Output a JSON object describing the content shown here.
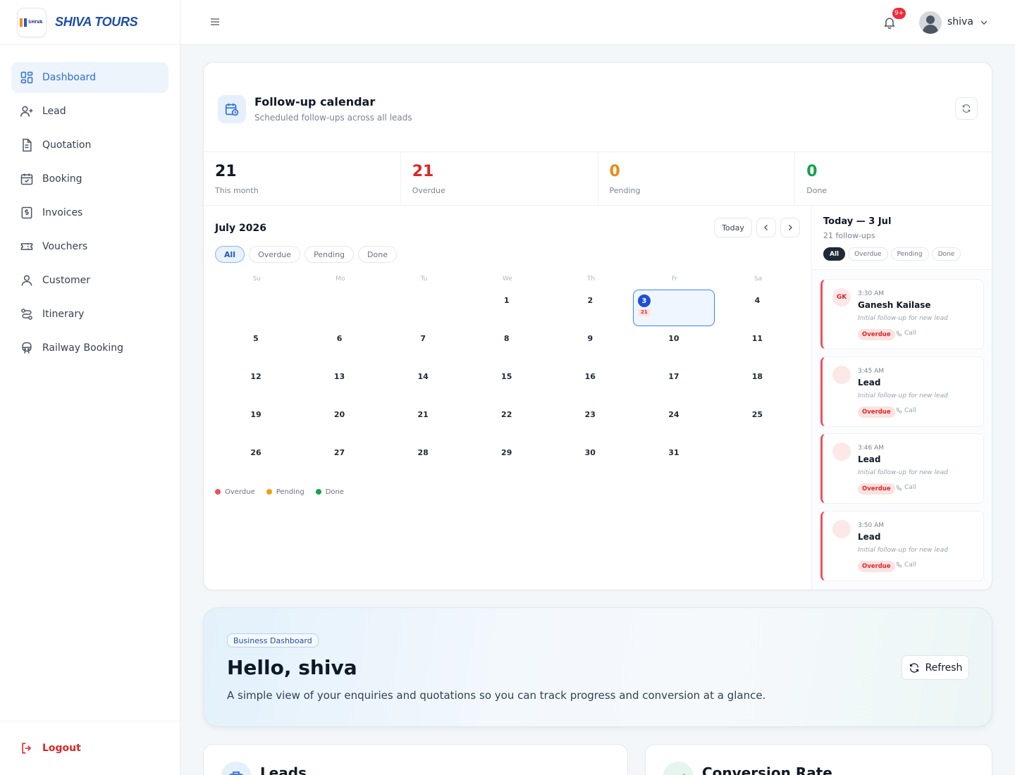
{
  "brand": {
    "name": "SHIVA TOURS",
    "logo_text": "SHIVA"
  },
  "sidebar": {
    "items": [
      {
        "label": "Dashboard",
        "icon": "dashboard-icon",
        "active": true
      },
      {
        "label": "Lead",
        "icon": "user-plus-icon"
      },
      {
        "label": "Quotation",
        "icon": "document-icon"
      },
      {
        "label": "Booking",
        "icon": "calendar-check-icon"
      },
      {
        "label": "Invoices",
        "icon": "invoice-dollar-icon"
      },
      {
        "label": "Vouchers",
        "icon": "ticket-icon"
      },
      {
        "label": "Customer",
        "icon": "user-icon"
      },
      {
        "label": "Itinerary",
        "icon": "route-icon"
      },
      {
        "label": "Railway Booking",
        "icon": "train-icon"
      }
    ],
    "logout_label": "Logout"
  },
  "topbar": {
    "notification_count": "9+",
    "username": "shiva"
  },
  "calendar": {
    "title": "Follow-up calendar",
    "subtitle": "Scheduled follow-ups across all leads",
    "stats": [
      {
        "value": "21",
        "label": "This month",
        "color": "#111827"
      },
      {
        "value": "21",
        "label": "Overdue",
        "color": "#dc2626"
      },
      {
        "value": "0",
        "label": "Pending",
        "color": "#ea8a12"
      },
      {
        "value": "0",
        "label": "Done",
        "color": "#16a34a"
      }
    ],
    "month_label": "July 2026",
    "today_label": "Today",
    "filters": [
      "All",
      "Overdue",
      "Pending",
      "Done"
    ],
    "active_filter": "All",
    "weekdays": [
      "Su",
      "Mo",
      "Tu",
      "We",
      "Th",
      "Fr",
      "Sa"
    ],
    "first_weekday_index": 3,
    "days_in_month": 31,
    "selected_day": 3,
    "selected_day_count": "21",
    "legend": [
      {
        "label": "Overdue",
        "color": "#ef4f5f"
      },
      {
        "label": "Pending",
        "color": "#f59e0b"
      },
      {
        "label": "Done",
        "color": "#16a34a"
      }
    ]
  },
  "today_panel": {
    "title": "Today — 3 Jul",
    "subtitle": "21 follow-ups",
    "filters": [
      "All",
      "Overdue",
      "Pending",
      "Done"
    ],
    "active_filter": "All",
    "items": [
      {
        "initials": "GK",
        "time": "3:30 AM",
        "name": "Ganesh Kailase",
        "note": "Initial follow-up for new lead",
        "status": "Overdue",
        "type": "Call"
      },
      {
        "initials": "",
        "time": "3:45 AM",
        "name": "Lead",
        "note": "Initial follow-up for new lead",
        "status": "Overdue",
        "type": "Call"
      },
      {
        "initials": "",
        "time": "3:46 AM",
        "name": "Lead",
        "note": "Initial follow-up for new lead",
        "status": "Overdue",
        "type": "Call"
      },
      {
        "initials": "",
        "time": "3:50 AM",
        "name": "Lead",
        "note": "Initial follow-up for new lead",
        "status": "Overdue",
        "type": "Call"
      }
    ]
  },
  "hello": {
    "badge": "Business Dashboard",
    "title": "Hello, shiva",
    "subtitle": "A simple view of your enquiries and quotations so you can track progress and conversion at a glance.",
    "refresh_label": "Refresh"
  },
  "cards": [
    {
      "title": "Leads",
      "icon": "briefcase-icon"
    },
    {
      "title": "Conversion Rate",
      "icon": "trend-icon"
    }
  ]
}
